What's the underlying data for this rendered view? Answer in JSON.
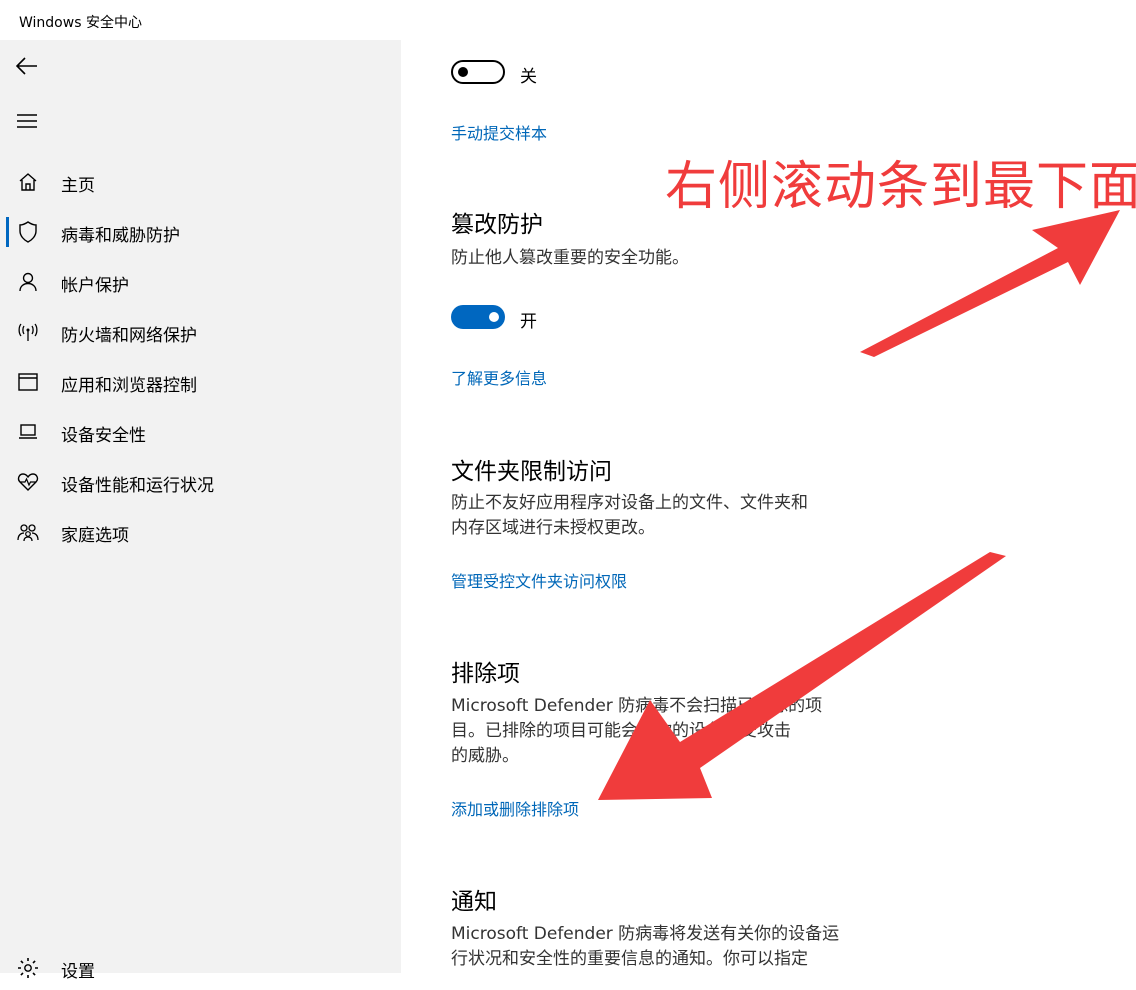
{
  "window": {
    "title": "Windows 安全中心"
  },
  "sidebar": {
    "nav": [
      {
        "label": "主页",
        "icon": "home-icon"
      },
      {
        "label": "病毒和威胁防护",
        "icon": "shield-icon",
        "selected": true
      },
      {
        "label": "帐户保护",
        "icon": "person-icon"
      },
      {
        "label": "防火墙和网络保护",
        "icon": "wifi-antenna-icon"
      },
      {
        "label": "应用和浏览器控制",
        "icon": "browser-window-icon"
      },
      {
        "label": "设备安全性",
        "icon": "laptop-icon"
      },
      {
        "label": "设备性能和运行状况",
        "icon": "heart-pulse-icon"
      },
      {
        "label": "家庭选项",
        "icon": "family-icon"
      }
    ],
    "settings_label": "设置",
    "accent_color": "#0067c0"
  },
  "main": {
    "sample_toggle": {
      "state_label": "关",
      "on": false
    },
    "submit_sample_link": "手动提交样本",
    "tamper": {
      "title": "篡改防护",
      "desc": "防止他人篡改重要的安全功能。",
      "state_label": "开",
      "on": true,
      "link": "了解更多信息"
    },
    "folder": {
      "title": "文件夹限制访问",
      "desc_line1": "防止不友好应用程序对设备上的文件、文件夹和",
      "desc_line2": "内存区域进行未授权更改。",
      "link": "管理受控文件夹访问权限"
    },
    "exclusions": {
      "title": "排除项",
      "desc_line1": "Microsoft Defender 防病毒不会扫描已排除的项",
      "desc_line2": "目。已排除的项目可能会使你的设备易受攻击",
      "desc_line3": "的威胁。",
      "link": "添加或删除排除项"
    },
    "notifications": {
      "title": "通知",
      "desc_line1": "Microsoft Defender 防病毒将发送有关你的设备运",
      "desc_line2": "行状况和安全性的重要信息的通知。你可以指定"
    },
    "link_color": "#0067b8"
  },
  "annotation": {
    "text": "右侧滚动条到最下面",
    "color": "#f03c3c"
  }
}
